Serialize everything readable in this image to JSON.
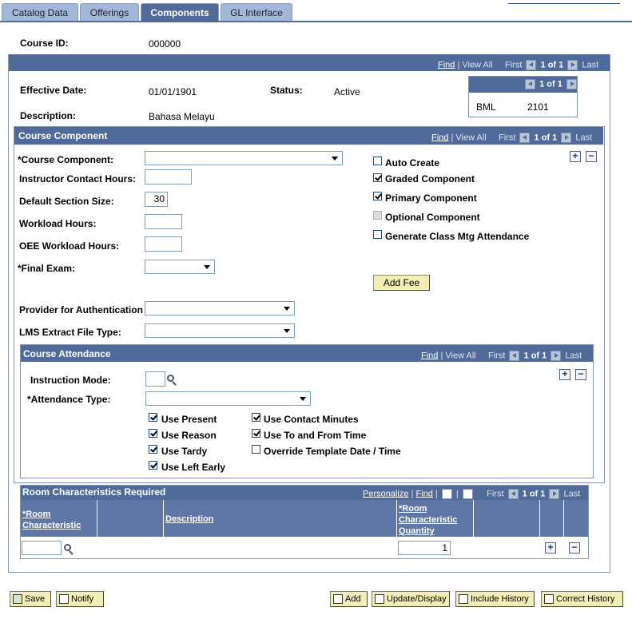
{
  "tabs": [
    {
      "label": "Catalog Data"
    },
    {
      "label": "Offerings"
    },
    {
      "label": "Components"
    },
    {
      "label": "GL Interface"
    }
  ],
  "course": {
    "id_label": "Course ID:",
    "id_value": "000000"
  },
  "main_nav": {
    "find": "Find",
    "view_all": "View All",
    "first": "First",
    "count": "1 of 1",
    "last": "Last"
  },
  "effective": {
    "date_label": "Effective Date:",
    "date_value": "01/01/1901",
    "status_label": "Status:",
    "status_value": "Active",
    "desc_label": "Description:",
    "desc_value": "Bahasa Melayu"
  },
  "mini_box": {
    "count": "1 of 1",
    "code": "BML",
    "number": "2101"
  },
  "component": {
    "title": "Course Component",
    "nav": {
      "find": "Find",
      "view_all": "View All",
      "first": "First",
      "count": "1 of 1",
      "last": "Last"
    },
    "fields": {
      "course_component": "*Course Component:",
      "instructor_hours": "Instructor Contact Hours:",
      "section_size": "Default Section Size:",
      "section_size_value": "30",
      "workload": "Workload Hours:",
      "oee_workload": "OEE Workload Hours:",
      "final_exam": "*Final Exam:",
      "provider": "Provider for Authentication",
      "lms": "LMS Extract File Type:"
    },
    "checks": {
      "auto_create": "Auto Create",
      "graded": "Graded Component",
      "primary": "Primary Component",
      "optional": "Optional Component",
      "generate": "Generate Class Mtg Attendance"
    },
    "add_fee": "Add Fee"
  },
  "attendance": {
    "title": "Course Attendance",
    "nav": {
      "find": "Find",
      "view_all": "View All",
      "first": "First",
      "count": "1 of 1",
      "last": "Last"
    },
    "instruction_mode": "Instruction Mode:",
    "attendance_type": "*Attendance Type:",
    "checks": {
      "use_present": "Use Present",
      "use_reason": "Use Reason",
      "use_tardy": "Use Tardy",
      "use_left_early": "Use Left Early",
      "use_contact": "Use Contact Minutes",
      "use_to_from": "Use To and From Time",
      "override": "Override Template Date / Time"
    }
  },
  "room": {
    "title": "Room Characteristics Required",
    "nav": {
      "personalize": "Personalize",
      "find": "Find",
      "first": "First",
      "count": "1 of 1",
      "last": "Last"
    },
    "columns": [
      "*Room Characteristic",
      "Description",
      "*Room Characteristic Quantity"
    ],
    "quantity_value": "1"
  },
  "toolbar": {
    "save": "Save",
    "notify": "Notify",
    "add": "Add",
    "update": "Update/Display",
    "include_history": "Include History",
    "correct_history": "Correct History"
  }
}
